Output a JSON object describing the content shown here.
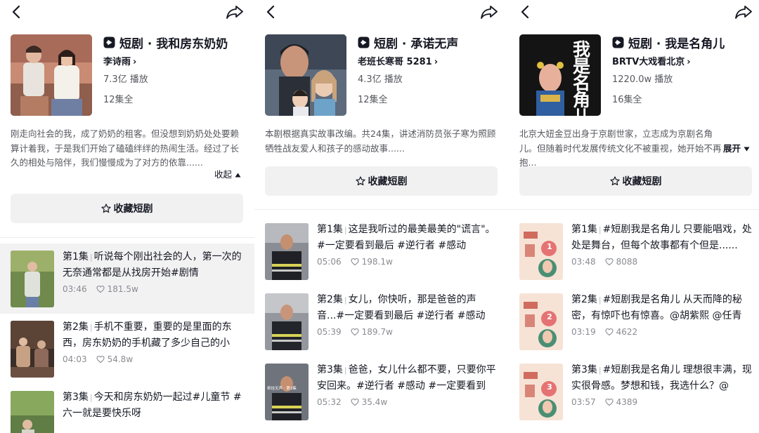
{
  "panels": [
    {
      "title": "短剧 · 我和房东奶奶",
      "author": "李诗雨",
      "plays": "7.3亿 播放",
      "episodes": "12集全",
      "description": "刚走向社会的我，成了奶奶的租客。但没想到奶奶处处要赖算计着我，于是我们开始了磕磕绊绊的热闹生活。经过了长久的相处与陪伴，我们慢慢成为了对方的依靠......",
      "desc_toggle": "收起",
      "favorite_label": "收藏短剧",
      "episode_list": [
        {
          "num": "第1集",
          "text": "听说每个刚出社会的人，第一次的无奈通常都是从找房开始#剧情",
          "duration": "03:46",
          "likes": "181.5w"
        },
        {
          "num": "第2集",
          "text": "手机不重要，重要的是里面的东西，房东奶奶的手机藏了多少自己的小",
          "duration": "04:03",
          "likes": "54.8w"
        },
        {
          "num": "第3集",
          "text": "今天和房东奶奶一起过#儿童节 #六一就是要快乐呀",
          "duration": "",
          "likes": ""
        }
      ]
    },
    {
      "title": "短剧 · 承诺无声",
      "author": "老班长寒哥 5281",
      "plays": "4.3亿 播放",
      "episodes": "12集全",
      "description": "本剧根据真实故事改编。共24集，讲述消防员张子寒为照顾牺牲战友爱人和孩子的感动故事......",
      "desc_toggle": "",
      "favorite_label": "收藏短剧",
      "episode_list": [
        {
          "num": "第1集",
          "text": "这是我听过的最美最美的\"谎言\"。#一定要看到最后 #逆行者 #感动",
          "duration": "05:06",
          "likes": "198.1w"
        },
        {
          "num": "第2集",
          "text": "女儿，你快听，那是爸爸的声音...#一定要看到最后 #逆行者 #感动",
          "duration": "05:39",
          "likes": "189.7w"
        },
        {
          "num": "第3集",
          "text": "爸爸，女儿什么都不要，只要你平安回来。#逆行者 #感动 #一定要看到",
          "duration": "05:32",
          "likes": "35.4w"
        }
      ],
      "thumb_caption": "牵挂无声 · 第3集"
    },
    {
      "title": "短剧 · 我是名角儿",
      "author": "BRTV大戏看北京",
      "plays": "1220.0w 播放",
      "episodes": "16集全",
      "description": "北京大妞金豆出身于京剧世家，立志成为京剧名角儿。但随着时代发展传统文化不被重视，她开始不再抱...",
      "desc_toggle": "展开",
      "favorite_label": "收藏短剧",
      "cover_text": "我是名角儿",
      "episode_list": [
        {
          "num": "第1集",
          "text": "#短剧我是名角儿 只要能唱戏，处处是舞台，但每个故事都有个但是......",
          "duration": "03:48",
          "likes": "8088",
          "badge": "1"
        },
        {
          "num": "第2集",
          "text": "#短剧我是名角儿 从天而降的秘密，有惊吓也有惊喜。@胡紫熙 @任青",
          "duration": "03:19",
          "likes": "4622",
          "badge": "2"
        },
        {
          "num": "第3集",
          "text": "#短剧我是名角儿 理想很丰满，现实很骨感。梦想和钱，我选什么？@",
          "duration": "03:57",
          "likes": "4389",
          "badge": "3"
        }
      ]
    }
  ],
  "icons": {
    "back": "chevron-left-icon",
    "share": "share-arrow-icon",
    "drama": "play-badge-icon",
    "favorite": "star-outline-icon",
    "likes": "heart-outline-icon"
  },
  "colors": {
    "text_primary": "#161823",
    "text_secondary": "#57585f",
    "button_bg": "#f1f1f2",
    "active_row_bg": "#f2f2f3"
  }
}
